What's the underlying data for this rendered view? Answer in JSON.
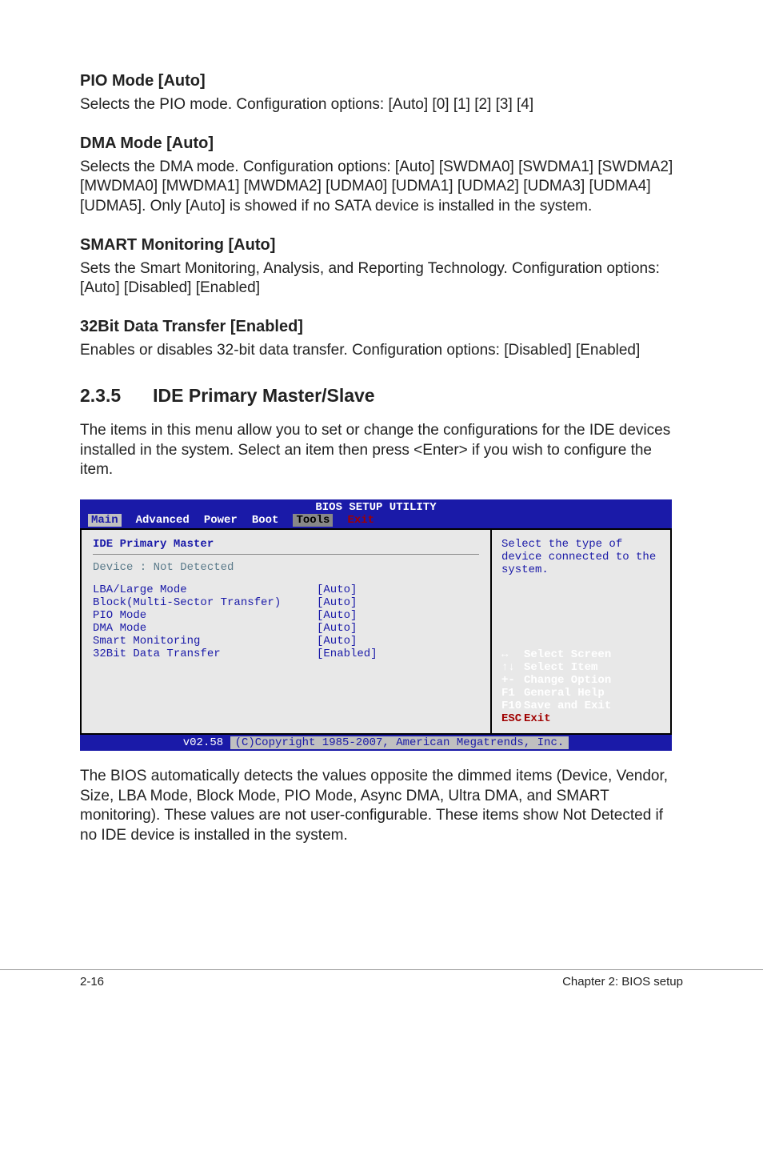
{
  "sections": {
    "pio": {
      "heading": "PIO Mode [Auto]",
      "body": "Selects the PIO mode. Configuration options: [Auto] [0] [1] [2] [3] [4]"
    },
    "dma": {
      "heading": "DMA Mode [Auto]",
      "body": "Selects the DMA mode. Configuration options: [Auto] [SWDMA0] [SWDMA1] [SWDMA2] [MWDMA0] [MWDMA1] [MWDMA2] [UDMA0] [UDMA1] [UDMA2] [UDMA3] [UDMA4] [UDMA5]. Only [Auto] is showed if no SATA device is installed in the system."
    },
    "smart": {
      "heading": "SMART Monitoring [Auto]",
      "body": "Sets the Smart Monitoring, Analysis, and Reporting Technology. Configuration options: [Auto] [Disabled] [Enabled]"
    },
    "bit32": {
      "heading": "32Bit Data Transfer [Enabled]",
      "body": "Enables or disables 32-bit data transfer. Configuration options: [Disabled] [Enabled]"
    }
  },
  "section235": {
    "num": "2.3.5",
    "title": "IDE Primary Master/Slave",
    "intro": "The items in this menu allow you to set or change the configurations for the IDE devices installed in the system. Select an item then press <Enter> if you wish to configure the item.",
    "outro": "The BIOS automatically detects the values opposite the dimmed items (Device, Vendor, Size, LBA Mode, Block Mode, PIO Mode, Async DMA, Ultra DMA, and SMART monitoring). These values are not user-configurable. These items show Not Detected if no IDE device is installed in the system."
  },
  "bios": {
    "title": "BIOS SETUP UTILITY",
    "tabs": {
      "main": "Main",
      "advanced": "Advanced",
      "power": "Power",
      "boot": "Boot",
      "tools": "Tools",
      "exit": "Exit"
    },
    "left": {
      "header": "IDE Primary Master",
      "device": "Device            : Not Detected",
      "rows": [
        {
          "label": "LBA/Large Mode",
          "value": "[Auto]"
        },
        {
          "label": "Block(Multi-Sector Transfer)",
          "value": "[Auto]"
        },
        {
          "label": "PIO Mode",
          "value": "[Auto]"
        },
        {
          "label": "DMA Mode",
          "value": "[Auto]"
        },
        {
          "label": "Smart Monitoring",
          "value": "[Auto]"
        },
        {
          "label": "32Bit Data Transfer",
          "value": "[Enabled]"
        }
      ]
    },
    "right": {
      "help": "Select the type of device connected to the system.",
      "keys": [
        {
          "k": "↔",
          "t": "Select Screen"
        },
        {
          "k": "↑↓",
          "t": "Select Item"
        },
        {
          "k": "+-",
          "t": "Change Option"
        },
        {
          "k": "F1",
          "t": "General Help"
        },
        {
          "k": "F10",
          "t": "Save and Exit"
        },
        {
          "k": "ESC",
          "t": "Exit"
        }
      ]
    },
    "footer": {
      "ver": "v02.58",
      "copy": "(C)Copyright 1985-2007, American Megatrends, Inc."
    }
  },
  "footer": {
    "left": "2-16",
    "right": "Chapter 2: BIOS setup"
  }
}
